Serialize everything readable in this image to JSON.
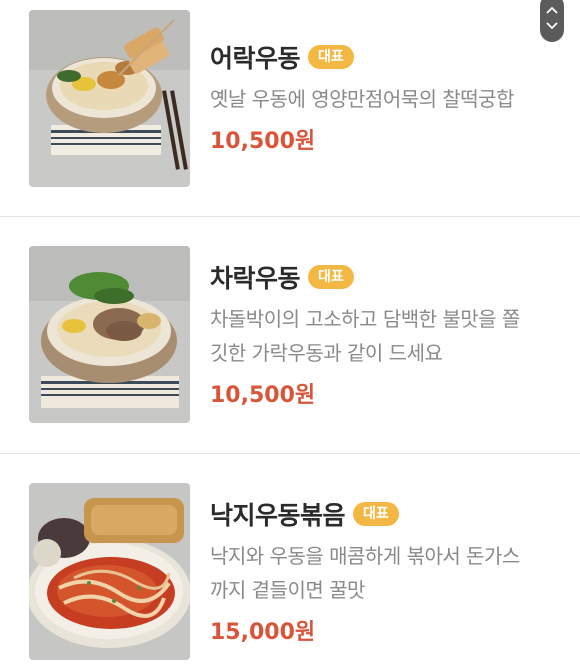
{
  "menu": {
    "items": [
      {
        "name": "어락우동",
        "badge": "대표",
        "description": "옛날 우동에 영양만점어묵의 찰떡궁합",
        "price": "10,500원",
        "image": "udon-with-fishcake-skewer-photo"
      },
      {
        "name": "차락우동",
        "badge": "대표",
        "description": "차돌박이의 고소하고 담백한 불맛을 쫄\n깃한 가락우동과 같이 드세요",
        "price": "10,500원",
        "image": "udon-with-beef-brisket-photo"
      },
      {
        "name": "낙지우동볶음",
        "badge": "대표",
        "description": "낙지와 우동을 매콤하게 볶아서 돈가스\n까지 곁들이면 꿀맛",
        "price": "15,000원",
        "image": "spicy-octopus-stir-fried-udon-photo"
      }
    ]
  },
  "scroll_control": {
    "up_icon": "chevron-up-icon",
    "down_icon": "chevron-down-icon"
  },
  "colors": {
    "badge": "#f3b843",
    "price": "#d9553a",
    "name": "#2b2b2b",
    "description": "#8a8a8a",
    "divider": "#e3e3e3"
  }
}
